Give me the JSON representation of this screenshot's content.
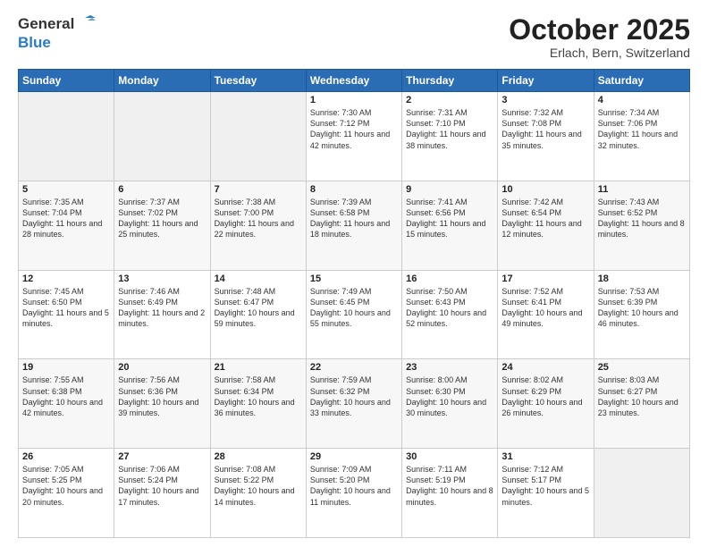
{
  "header": {
    "logo_line1": "General",
    "logo_line2": "Blue",
    "month": "October 2025",
    "location": "Erlach, Bern, Switzerland"
  },
  "days_of_week": [
    "Sunday",
    "Monday",
    "Tuesday",
    "Wednesday",
    "Thursday",
    "Friday",
    "Saturday"
  ],
  "weeks": [
    [
      {
        "day": "",
        "info": ""
      },
      {
        "day": "",
        "info": ""
      },
      {
        "day": "",
        "info": ""
      },
      {
        "day": "1",
        "info": "Sunrise: 7:30 AM\nSunset: 7:12 PM\nDaylight: 11 hours\nand 42 minutes."
      },
      {
        "day": "2",
        "info": "Sunrise: 7:31 AM\nSunset: 7:10 PM\nDaylight: 11 hours\nand 38 minutes."
      },
      {
        "day": "3",
        "info": "Sunrise: 7:32 AM\nSunset: 7:08 PM\nDaylight: 11 hours\nand 35 minutes."
      },
      {
        "day": "4",
        "info": "Sunrise: 7:34 AM\nSunset: 7:06 PM\nDaylight: 11 hours\nand 32 minutes."
      }
    ],
    [
      {
        "day": "5",
        "info": "Sunrise: 7:35 AM\nSunset: 7:04 PM\nDaylight: 11 hours\nand 28 minutes."
      },
      {
        "day": "6",
        "info": "Sunrise: 7:37 AM\nSunset: 7:02 PM\nDaylight: 11 hours\nand 25 minutes."
      },
      {
        "day": "7",
        "info": "Sunrise: 7:38 AM\nSunset: 7:00 PM\nDaylight: 11 hours\nand 22 minutes."
      },
      {
        "day": "8",
        "info": "Sunrise: 7:39 AM\nSunset: 6:58 PM\nDaylight: 11 hours\nand 18 minutes."
      },
      {
        "day": "9",
        "info": "Sunrise: 7:41 AM\nSunset: 6:56 PM\nDaylight: 11 hours\nand 15 minutes."
      },
      {
        "day": "10",
        "info": "Sunrise: 7:42 AM\nSunset: 6:54 PM\nDaylight: 11 hours\nand 12 minutes."
      },
      {
        "day": "11",
        "info": "Sunrise: 7:43 AM\nSunset: 6:52 PM\nDaylight: 11 hours\nand 8 minutes."
      }
    ],
    [
      {
        "day": "12",
        "info": "Sunrise: 7:45 AM\nSunset: 6:50 PM\nDaylight: 11 hours\nand 5 minutes."
      },
      {
        "day": "13",
        "info": "Sunrise: 7:46 AM\nSunset: 6:49 PM\nDaylight: 11 hours\nand 2 minutes."
      },
      {
        "day": "14",
        "info": "Sunrise: 7:48 AM\nSunset: 6:47 PM\nDaylight: 10 hours\nand 59 minutes."
      },
      {
        "day": "15",
        "info": "Sunrise: 7:49 AM\nSunset: 6:45 PM\nDaylight: 10 hours\nand 55 minutes."
      },
      {
        "day": "16",
        "info": "Sunrise: 7:50 AM\nSunset: 6:43 PM\nDaylight: 10 hours\nand 52 minutes."
      },
      {
        "day": "17",
        "info": "Sunrise: 7:52 AM\nSunset: 6:41 PM\nDaylight: 10 hours\nand 49 minutes."
      },
      {
        "day": "18",
        "info": "Sunrise: 7:53 AM\nSunset: 6:39 PM\nDaylight: 10 hours\nand 46 minutes."
      }
    ],
    [
      {
        "day": "19",
        "info": "Sunrise: 7:55 AM\nSunset: 6:38 PM\nDaylight: 10 hours\nand 42 minutes."
      },
      {
        "day": "20",
        "info": "Sunrise: 7:56 AM\nSunset: 6:36 PM\nDaylight: 10 hours\nand 39 minutes."
      },
      {
        "day": "21",
        "info": "Sunrise: 7:58 AM\nSunset: 6:34 PM\nDaylight: 10 hours\nand 36 minutes."
      },
      {
        "day": "22",
        "info": "Sunrise: 7:59 AM\nSunset: 6:32 PM\nDaylight: 10 hours\nand 33 minutes."
      },
      {
        "day": "23",
        "info": "Sunrise: 8:00 AM\nSunset: 6:30 PM\nDaylight: 10 hours\nand 30 minutes."
      },
      {
        "day": "24",
        "info": "Sunrise: 8:02 AM\nSunset: 6:29 PM\nDaylight: 10 hours\nand 26 minutes."
      },
      {
        "day": "25",
        "info": "Sunrise: 8:03 AM\nSunset: 6:27 PM\nDaylight: 10 hours\nand 23 minutes."
      }
    ],
    [
      {
        "day": "26",
        "info": "Sunrise: 7:05 AM\nSunset: 5:25 PM\nDaylight: 10 hours\nand 20 minutes."
      },
      {
        "day": "27",
        "info": "Sunrise: 7:06 AM\nSunset: 5:24 PM\nDaylight: 10 hours\nand 17 minutes."
      },
      {
        "day": "28",
        "info": "Sunrise: 7:08 AM\nSunset: 5:22 PM\nDaylight: 10 hours\nand 14 minutes."
      },
      {
        "day": "29",
        "info": "Sunrise: 7:09 AM\nSunset: 5:20 PM\nDaylight: 10 hours\nand 11 minutes."
      },
      {
        "day": "30",
        "info": "Sunrise: 7:11 AM\nSunset: 5:19 PM\nDaylight: 10 hours\nand 8 minutes."
      },
      {
        "day": "31",
        "info": "Sunrise: 7:12 AM\nSunset: 5:17 PM\nDaylight: 10 hours\nand 5 minutes."
      },
      {
        "day": "",
        "info": ""
      }
    ]
  ]
}
